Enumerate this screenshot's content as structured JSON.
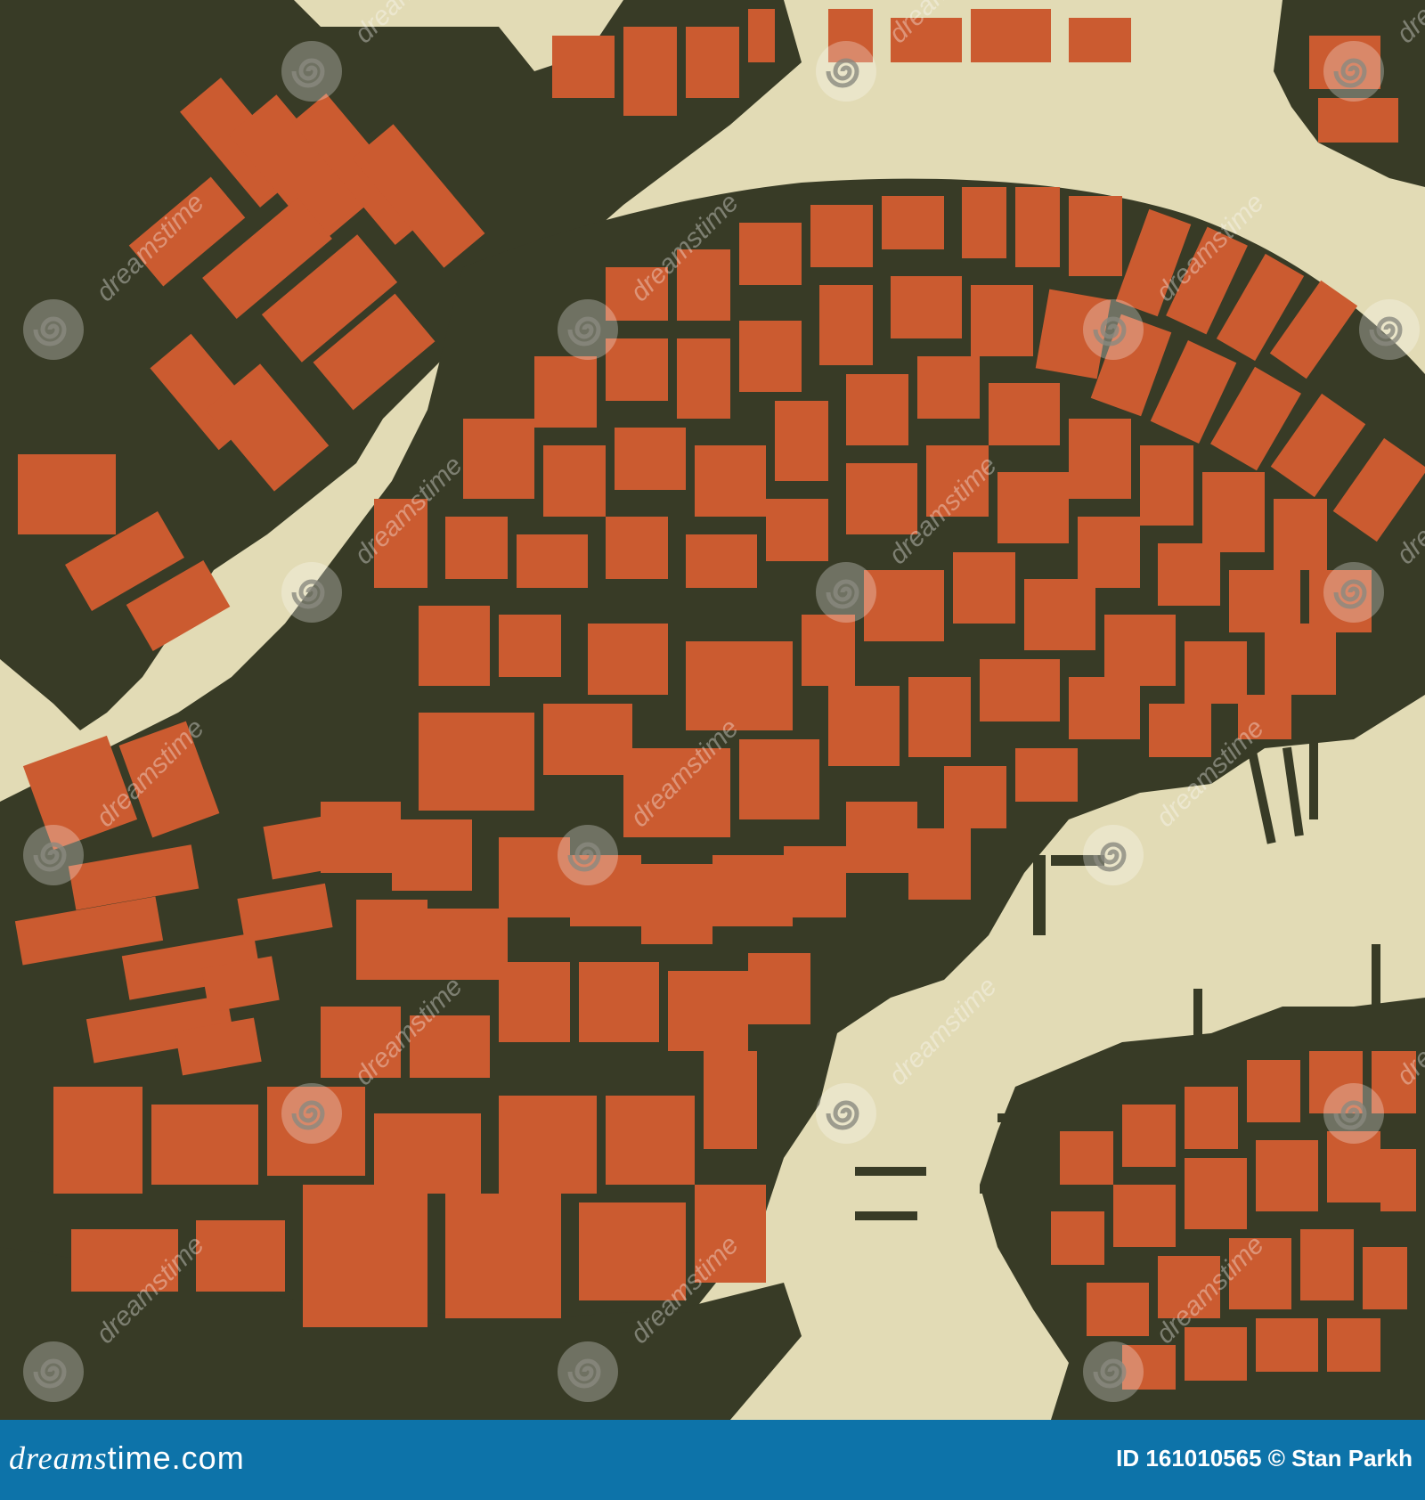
{
  "map": {
    "colors": {
      "water": "#e2dbb5",
      "streets": "#383b26",
      "buildings": "#cb5b30",
      "watermark": "#ffffff"
    },
    "watermark": {
      "text": "dreamstime",
      "icon": "spiral-logo-icon"
    }
  },
  "footer": {
    "site_part1": "dreams",
    "site_part2": "time.com",
    "image_id": "ID 161010565",
    "copyright": "© Stan Parkh",
    "bar_color": "#0d73a9"
  }
}
